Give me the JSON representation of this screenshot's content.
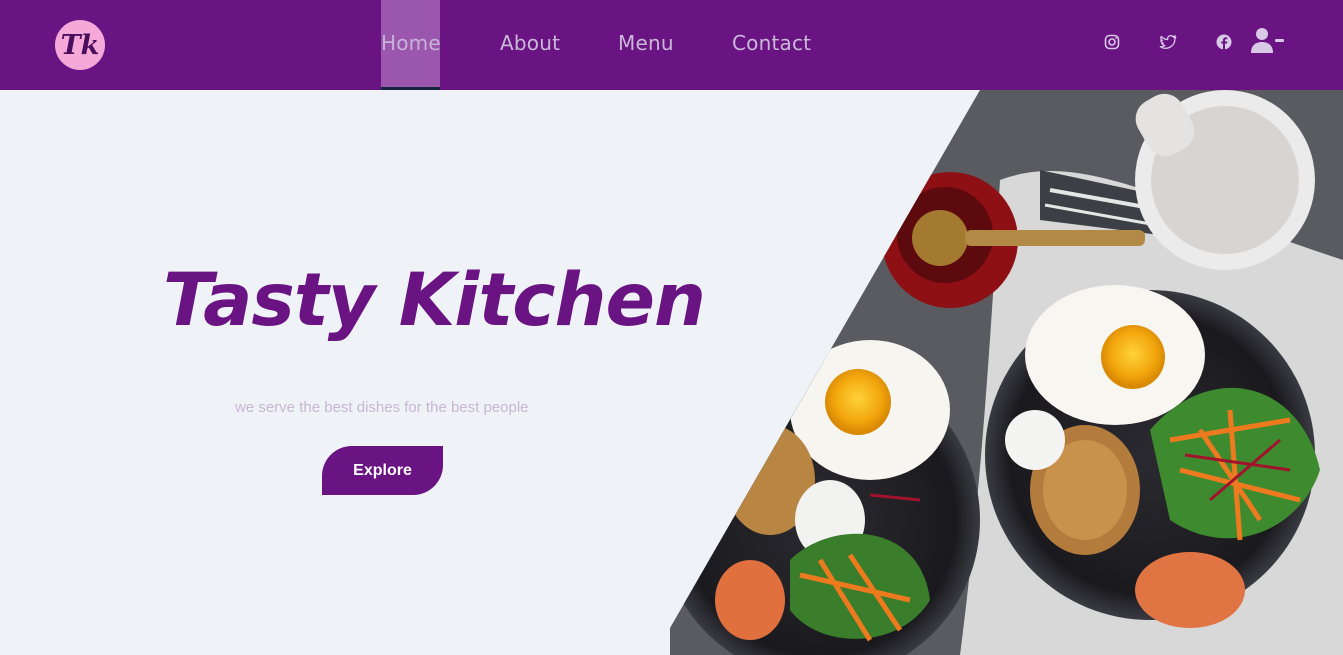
{
  "brand": {
    "logo_text": "Tk"
  },
  "nav": {
    "items": [
      {
        "label": "Home",
        "active": true
      },
      {
        "label": "About",
        "active": false
      },
      {
        "label": "Menu",
        "active": false
      },
      {
        "label": "Contact",
        "active": false
      }
    ]
  },
  "social": [
    {
      "icon": "instagram-icon"
    },
    {
      "icon": "twitter-icon"
    },
    {
      "icon": "facebook-icon"
    },
    {
      "icon": "user-minus-icon"
    }
  ],
  "hero": {
    "title": "Tasty Kitchen",
    "subtitle": "we serve the best dishes for the best people",
    "cta_label": "Explore",
    "image": "breakfast-plates-photo"
  },
  "colors": {
    "brand_purple": "#6a1382",
    "logo_pink": "#f6a9d9",
    "page_bg": "#eff3f8",
    "active_nav_bg": "#9b57ae",
    "subtitle": "#c8b6d2"
  }
}
